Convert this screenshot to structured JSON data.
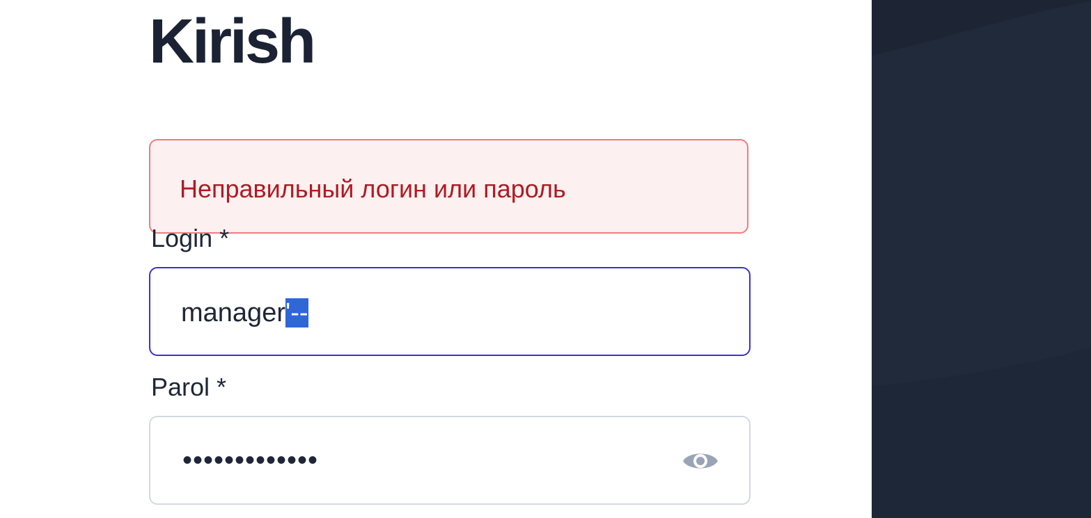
{
  "app": {
    "title": "Kirish"
  },
  "error": {
    "message": "Неправильный логин или пароль",
    "colors": {
      "border": "#ee7b80",
      "background": "#fdf0f0",
      "text": "#b01a22"
    }
  },
  "form": {
    "login": {
      "label": "Login *",
      "value_plain": "manager",
      "value_selected": "'--",
      "state": "focused"
    },
    "password": {
      "label": "Parol *",
      "masked_value": "•••••••••••••",
      "toggle_icon": "eye-icon"
    }
  },
  "theme": {
    "accent": "#3b2fd6",
    "side_panel": "#212a3a",
    "selection": "#2f66d8"
  }
}
